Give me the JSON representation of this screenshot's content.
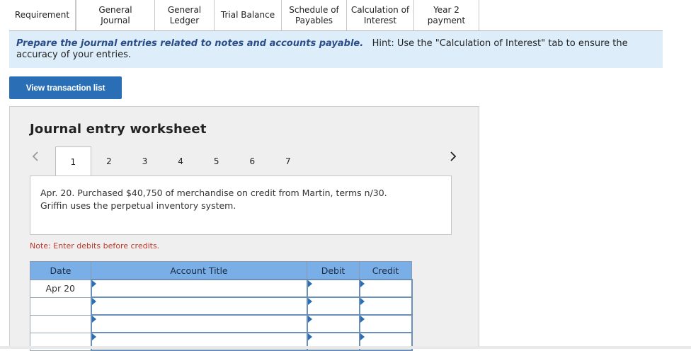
{
  "tabs": [
    {
      "label": "Requirement",
      "active": false
    },
    {
      "label": "General\nJournal",
      "active": true
    },
    {
      "label": "General\nLedger",
      "active": false
    },
    {
      "label": "Trial Balance",
      "active": false
    },
    {
      "label": "Schedule of\nPayables",
      "active": false
    },
    {
      "label": "Calculation of\nInterest",
      "active": false
    },
    {
      "label": "Year 2\npayment",
      "active": false
    }
  ],
  "instructions": {
    "lead": "Prepare the journal entries related to notes and accounts payable.",
    "hint": "Hint:  Use the \"Calculation of Interest\" tab to ensure the accuracy of your entries."
  },
  "view_button_label": "View transaction list",
  "worksheet": {
    "title": "Journal entry worksheet",
    "pages": [
      "1",
      "2",
      "3",
      "4",
      "5",
      "6",
      "7"
    ],
    "active_page": "1",
    "transaction_line1": "Apr. 20. Purchased $40,750 of merchandise on credit from Martin, terms n/30.",
    "transaction_line2": "Griffin uses the perpetual inventory system.",
    "note": "Note: Enter debits before credits."
  },
  "table": {
    "headers": {
      "date": "Date",
      "account": "Account Title",
      "debit": "Debit",
      "credit": "Credit"
    },
    "rows": [
      {
        "date": "Apr 20",
        "account": "",
        "debit": "",
        "credit": ""
      },
      {
        "date": "",
        "account": "",
        "debit": "",
        "credit": ""
      },
      {
        "date": "",
        "account": "",
        "debit": "",
        "credit": ""
      },
      {
        "date": "",
        "account": "",
        "debit": "",
        "credit": ""
      }
    ]
  },
  "colors": {
    "accent": "#2a6fb5",
    "header_blue": "#7aaee6",
    "instruction_bg": "#ddeefa",
    "note_red": "#c0392b"
  }
}
